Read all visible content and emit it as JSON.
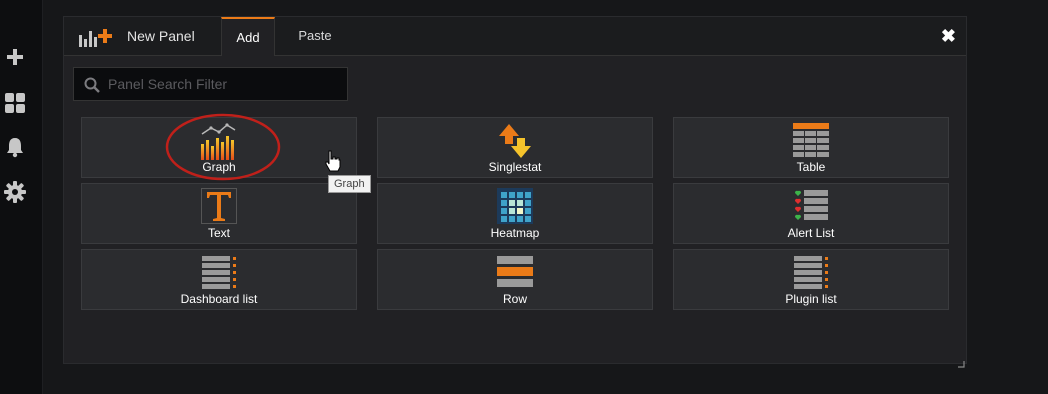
{
  "sidebar": {
    "items": [
      {
        "name": "plus-icon"
      },
      {
        "name": "dashboards-icon"
      },
      {
        "name": "bell-icon"
      },
      {
        "name": "gear-icon"
      }
    ]
  },
  "panel": {
    "title": "New Panel",
    "tabs": [
      {
        "label": "Add",
        "active": true
      },
      {
        "label": "Paste",
        "active": false
      }
    ],
    "close_glyph": "✖",
    "search": {
      "placeholder": "Panel Search Filter",
      "value": ""
    },
    "cards": [
      {
        "label": "Graph",
        "icon": "graph-icon"
      },
      {
        "label": "Singlestat",
        "icon": "singlestat-icon"
      },
      {
        "label": "Table",
        "icon": "table-icon"
      },
      {
        "label": "Text",
        "icon": "text-icon"
      },
      {
        "label": "Heatmap",
        "icon": "heatmap-icon"
      },
      {
        "label": "Alert List",
        "icon": "alert-list-icon"
      },
      {
        "label": "Dashboard list",
        "icon": "dashboard-list-icon"
      },
      {
        "label": "Row",
        "icon": "row-icon"
      },
      {
        "label": "Plugin list",
        "icon": "plugin-list-icon"
      }
    ],
    "tooltip": "Graph"
  },
  "colors": {
    "accent": "#eb7b18",
    "highlight_ring": "#c0201a",
    "background": "#161719",
    "panel": "#212124",
    "card": "#2b2c2f"
  }
}
